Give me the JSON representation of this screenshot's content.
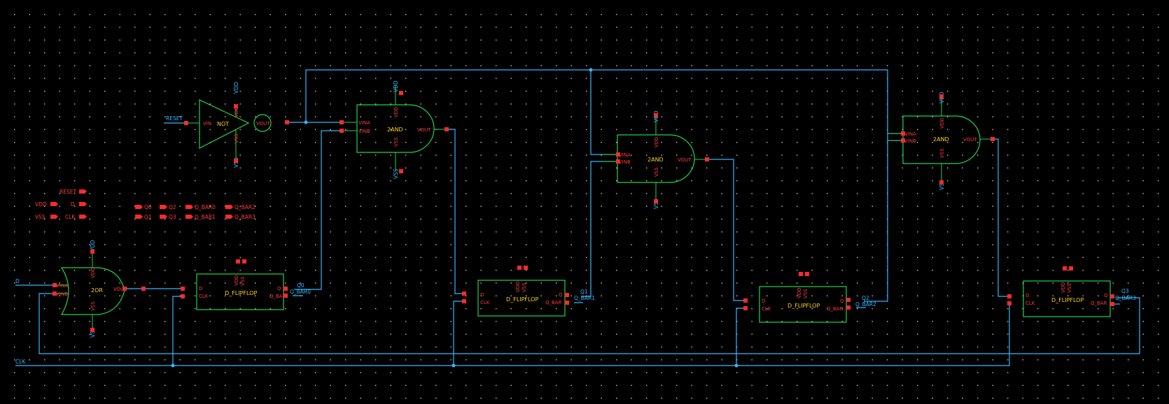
{
  "colors": {
    "background": "#000000",
    "wire": "#35b7ff",
    "body": "#21d44b",
    "pin": "#ff2a2a",
    "label": "#ffd21a",
    "grid": "#d8d8d8"
  },
  "instances": {
    "not": {
      "name": "NOT",
      "in": "VIN",
      "out": "VOUT",
      "vdd": "VDD",
      "vss": "VSS"
    },
    "and1": {
      "name": "2AND",
      "a": "VINA",
      "b": "VINB",
      "out": "VOUT",
      "vdd": "VDD",
      "vss": "VSS"
    },
    "and2": {
      "name": "2AND",
      "a": "VINA",
      "b": "VINB",
      "out": "VOUT",
      "vdd": "VDD",
      "vss": "VSS"
    },
    "and3": {
      "name": "2AND",
      "a": "VINA",
      "b": "VINB",
      "out": "VOUT",
      "vdd": "VDD",
      "vss": "VSS"
    },
    "or": {
      "name": "2OR",
      "a": "VINA",
      "b": "VINB",
      "out": "VOUT",
      "vdd": "VDD",
      "vss": "VSS"
    },
    "dff": {
      "name": "D_FLIPFLOP",
      "d": "D",
      "clk": "CLK",
      "q": "Q",
      "qbar": "Q_BAR",
      "vdd": "VDD",
      "vss": "VSS"
    }
  },
  "nets": {
    "reset": "RESET",
    "d": "D",
    "clk": "CLK",
    "q0": "Q0",
    "qbar0": "Q_BAR0",
    "q1": "Q1",
    "qbar1": "Q_BAR1",
    "q2": "Q2",
    "qbar2": "Q_BAR2",
    "q3": "Q3",
    "qbar3": "Q_BAR3"
  },
  "pins": {
    "left": [
      "RESET",
      "VDD",
      "D",
      "VSS",
      "CLK"
    ],
    "right": [
      "Q0",
      "Q2",
      "Q_BAR0",
      "Q_BAR2",
      "Q1",
      "Q3",
      "Q_BAR1",
      "Q_BAR3"
    ]
  }
}
